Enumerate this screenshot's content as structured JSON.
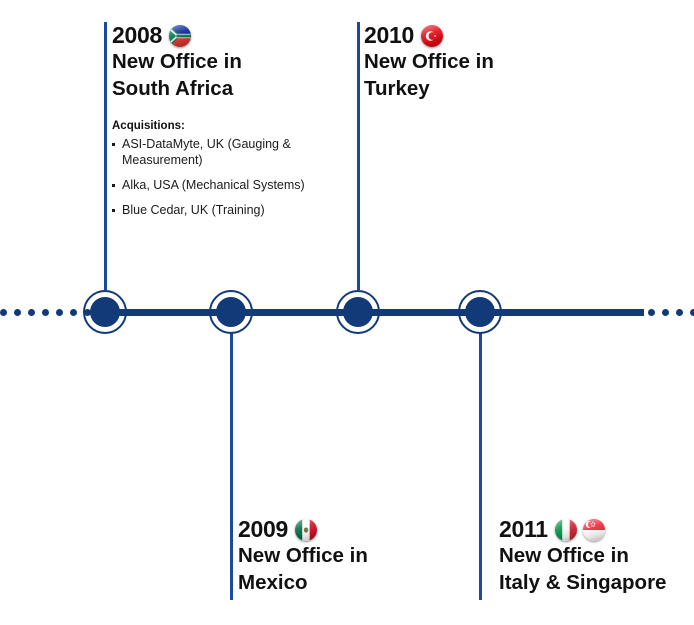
{
  "theme": {
    "line_color": "#123a78",
    "connector_color": "#1b4a9c",
    "text_color": "#111111"
  },
  "axis": {
    "label": "company-history-timeline-axis"
  },
  "events": [
    {
      "year": "2008",
      "title_line1": "New Office in",
      "title_line2": "South Africa",
      "flags": [
        "south-africa"
      ],
      "position": "above",
      "acquisitions": {
        "heading": "Acquisitions:",
        "items": [
          "ASI-DataMyte, UK (Gauging & Measurement)",
          "Alka, USA (Mechanical Systems)",
          "Blue Cedar, UK (Training)"
        ]
      }
    },
    {
      "year": "2009",
      "title_line1": "New Office in",
      "title_line2": "Mexico",
      "flags": [
        "mexico"
      ],
      "position": "below"
    },
    {
      "year": "2010",
      "title_line1": "New Office in",
      "title_line2": "Turkey",
      "flags": [
        "turkey"
      ],
      "position": "above"
    },
    {
      "year": "2011",
      "title_line1": "New Office in",
      "title_line2": "Italy & Singapore",
      "flags": [
        "italy",
        "singapore"
      ],
      "position": "below"
    }
  ]
}
